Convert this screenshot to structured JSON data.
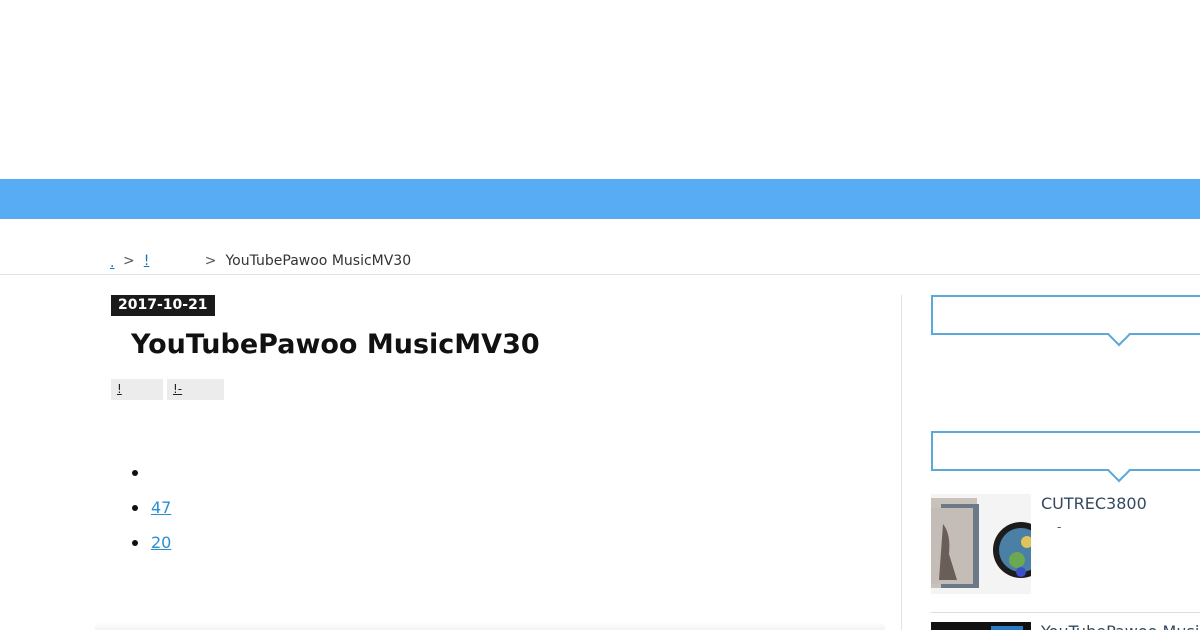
{
  "breadcrumb": {
    "home": ".",
    "separator": ">",
    "category": "!",
    "current": "YouTubePawoo MusicMV30"
  },
  "post": {
    "date": "2017-10-21",
    "title": "YouTubePawoo MusicMV30",
    "tags": [
      "!",
      "!-"
    ]
  },
  "toc": {
    "items": [
      "",
      "47",
      "20"
    ]
  },
  "sidebar": {
    "ranking": [
      {
        "title": "CUTREC3800",
        "meta": "-"
      },
      {
        "title": "YouTubePawoo Music"
      }
    ]
  },
  "colors": {
    "nav_bar": "#58acf4",
    "accent_border": "#5ba8d9",
    "link": "#2a8fd0",
    "date_badge": "#1a1a1a"
  }
}
